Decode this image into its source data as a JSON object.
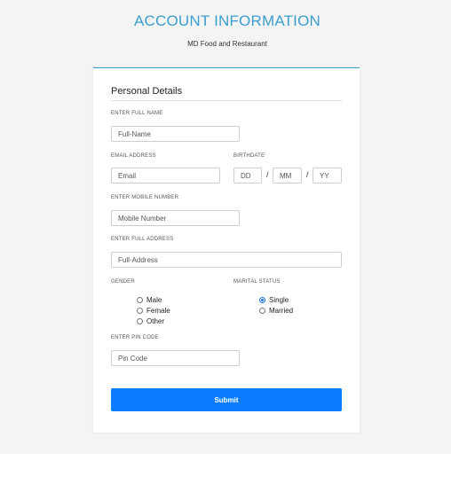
{
  "header": {
    "title": "ACCOUNT INFORMATION",
    "subtitle": "MD Food and Restaurant"
  },
  "form": {
    "section_title": "Personal Details",
    "full_name": {
      "label": "ENTER FULL NAME",
      "placeholder": "Full-Name",
      "value": ""
    },
    "email": {
      "label": "EMAIL ADDRESS",
      "placeholder": "Email",
      "value": ""
    },
    "birthdate": {
      "label": "BIRTHDATE",
      "day_placeholder": "DD",
      "month_placeholder": "MM",
      "year_placeholder": "YY",
      "separator": "/"
    },
    "mobile": {
      "label": "ENTER MOBILE NUMBER",
      "placeholder": "Mobile Number",
      "value": ""
    },
    "address": {
      "label": "ENTER FULL ADDRESS",
      "placeholder": "Full-Address",
      "value": ""
    },
    "gender": {
      "label": "GENDER",
      "options": [
        "Male",
        "Female",
        "Other"
      ],
      "selected": null
    },
    "marital_status": {
      "label": "MARITAL STATUS",
      "options": [
        "Single",
        "Married"
      ],
      "selected": "Single"
    },
    "pin": {
      "label": "ENTER PIN CODE",
      "placeholder": "Pin Code",
      "value": ""
    },
    "submit_label": "Submit"
  },
  "colors": {
    "accent": "#3a9fcc",
    "button": "#0a7cff",
    "page_background": "#f4f4f4"
  }
}
